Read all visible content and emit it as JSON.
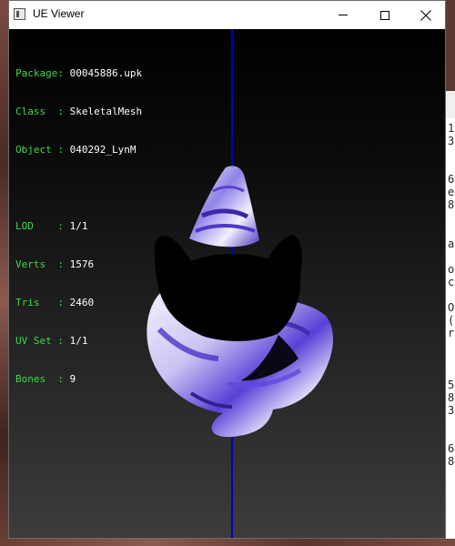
{
  "window": {
    "title": "UE Viewer",
    "buttons": {
      "minimize": "minimize",
      "maximize": "maximize",
      "close": "close"
    }
  },
  "info_panel": {
    "package": {
      "label": "Package:",
      "value": "00045886.upk"
    },
    "class": {
      "label": "Class  :",
      "value": "SkeletalMesh"
    },
    "object": {
      "label": "Object :",
      "value": "040292_LynM"
    },
    "lod": {
      "label": "LOD    :",
      "value": "1/1"
    },
    "verts": {
      "label": "Verts  :",
      "value": "1576"
    },
    "tris": {
      "label": "Tris   :",
      "value": "2460"
    },
    "uv_set": {
      "label": "UV Set :",
      "value": "1/1"
    },
    "bones": {
      "label": "Bones  :",
      "value": "9"
    }
  },
  "background_text": {
    "right_column": [
      "1",
      "3",
      "6",
      "e",
      "8",
      "a",
      "o",
      "c",
      "O",
      "(",
      "r",
      "5",
      "8",
      "3",
      "6",
      "8"
    ]
  },
  "colors": {
    "info_label": "#3fd94a",
    "info_value": "#ffffff",
    "axis_line": "#0000c8",
    "mesh_dark": "#000000",
    "mesh_accent": "#5a3fd6",
    "mesh_light": "#eceaf8"
  }
}
